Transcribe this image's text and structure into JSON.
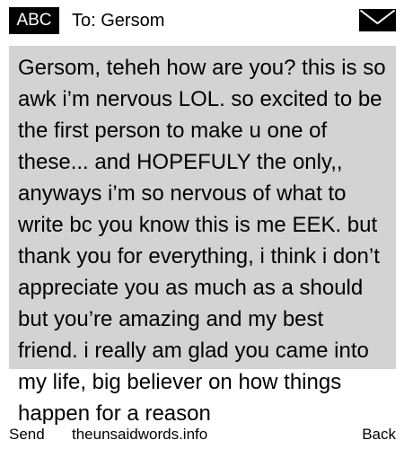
{
  "header": {
    "mode_label": "ABC",
    "recipient_label": "To: Gersom",
    "icon": "envelope-icon"
  },
  "message": {
    "body": "Gersom, teheh how are you? this is so awk i’m nervous LOL. so excited to be the first person to make u one of these... and HOPEFULY the only,, anyways i’m so nervous of what to write bc you know this is me EEK. but thank you for everything, i think i don’t appreciate you as much as a should but you’re amazing and my best friend. i really am glad you came into my life, big believer on how things happen for a reason"
  },
  "softkeys": {
    "left": "Send",
    "center": "theunsaidwords.info",
    "right": "Back"
  }
}
